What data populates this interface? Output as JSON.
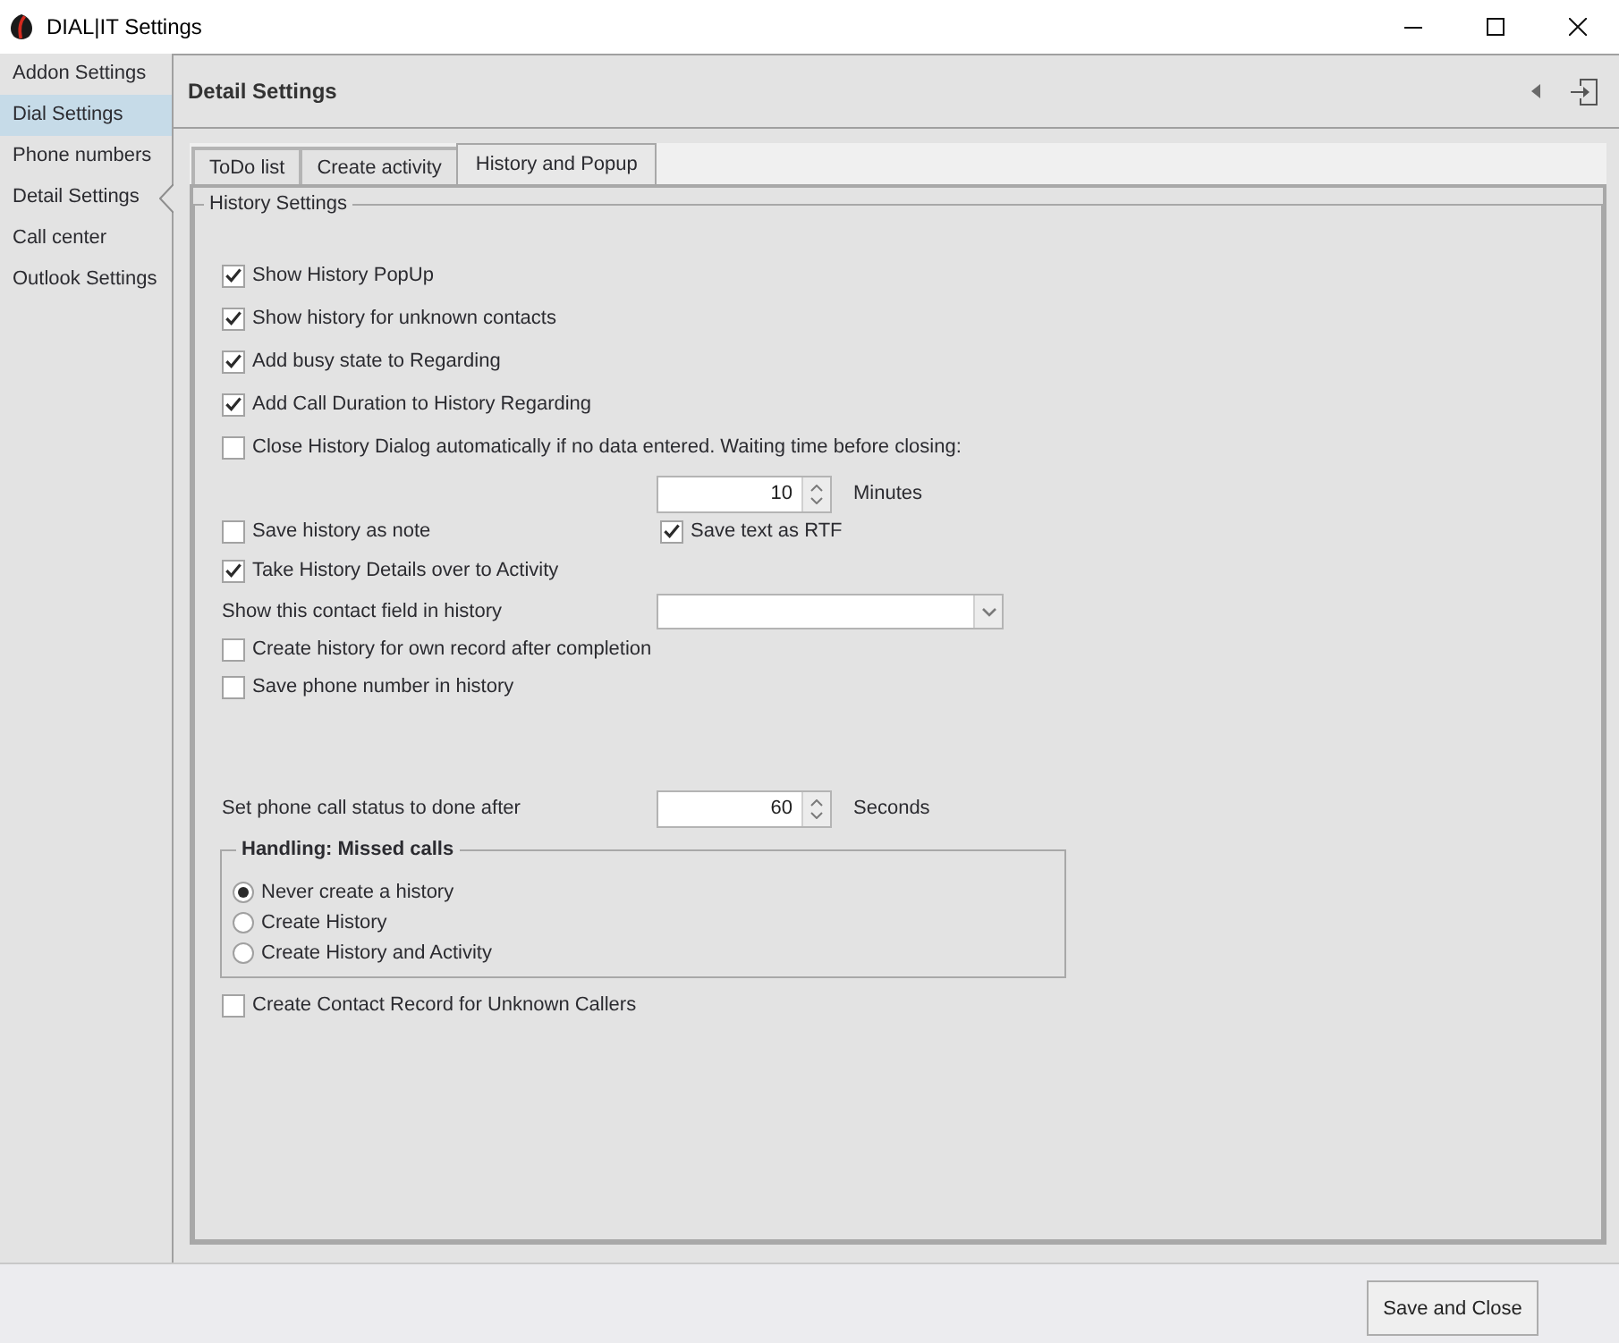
{
  "window": {
    "title": "DIAL|IT Settings"
  },
  "sidebar": {
    "items": [
      {
        "label": "Addon Settings",
        "hovered": false,
        "selected": false
      },
      {
        "label": "Dial Settings",
        "hovered": true,
        "selected": false
      },
      {
        "label": "Phone numbers",
        "hovered": false,
        "selected": false
      },
      {
        "label": "Detail Settings",
        "hovered": false,
        "selected": true
      },
      {
        "label": "Call center",
        "hovered": false,
        "selected": false
      },
      {
        "label": "Outlook Settings",
        "hovered": false,
        "selected": false
      }
    ]
  },
  "header": {
    "title": "Detail Settings"
  },
  "tabs": [
    {
      "label": "ToDo list",
      "selected": false
    },
    {
      "label": "Create activity",
      "selected": false
    },
    {
      "label": "History and Popup",
      "selected": true
    }
  ],
  "history_settings": {
    "title": "History Settings",
    "options": [
      {
        "label": "Show History PopUp",
        "checked": true
      },
      {
        "label": "Show history for unknown contacts",
        "checked": true
      },
      {
        "label": "Add busy state to Regarding",
        "checked": true
      },
      {
        "label": "Add Call Duration to History Regarding",
        "checked": true
      },
      {
        "label": "Close History Dialog automatically if no data entered. Waiting time before closing:",
        "checked": false
      }
    ],
    "closing_wait": {
      "value": "10",
      "unit": "Minutes"
    },
    "save_options": [
      {
        "label": "Save history as note",
        "checked": false
      },
      {
        "label": "Save text as RTF",
        "checked": true
      }
    ],
    "take_details": {
      "label": "Take History Details over to Activity",
      "checked": true
    },
    "contact_field": {
      "label": "Show this contact field in history"
    },
    "record_options": [
      {
        "label": "Create history for own record after completion",
        "checked": false
      },
      {
        "label": "Save phone number in history",
        "checked": false
      }
    ],
    "done_after": {
      "label": "Set phone call status to done after",
      "value": "60",
      "unit": "Seconds"
    },
    "missed_calls": {
      "title": "Handling: Missed calls",
      "options": [
        {
          "label": "Never create a history",
          "selected": true
        },
        {
          "label": "Create History",
          "selected": false
        },
        {
          "label": "Create History and Activity",
          "selected": false
        }
      ]
    },
    "create_contact": {
      "label": "Create Contact Record for Unknown Callers",
      "checked": false
    }
  },
  "footer": {
    "buttons": [
      "Save and Close"
    ]
  }
}
